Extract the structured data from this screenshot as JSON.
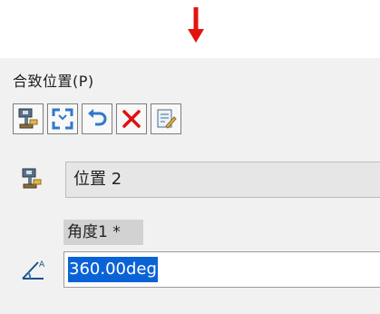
{
  "panel": {
    "title": "合致位置(P)"
  },
  "toolbar": {
    "buttons": [
      {
        "icon": "mate-position-icon"
      },
      {
        "icon": "expand-icon"
      },
      {
        "icon": "undo-icon"
      },
      {
        "icon": "delete-icon"
      },
      {
        "icon": "edit-icon"
      }
    ]
  },
  "position": {
    "icon": "mate-position-icon",
    "value": "位置 2"
  },
  "angle": {
    "label": "角度1 *",
    "icon": "angle-icon",
    "value": "360.00deg"
  },
  "colors": {
    "arrow": "#e3140f",
    "panel_bg": "#f1f1f1",
    "selection": "#0a63d6",
    "delete_red": "#e01010"
  }
}
